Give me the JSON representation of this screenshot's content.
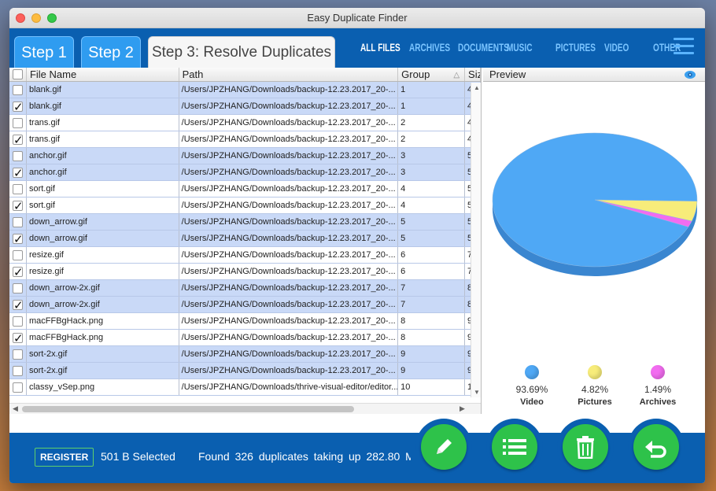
{
  "window": {
    "title": "Easy Duplicate Finder"
  },
  "steps": {
    "step1": "Step 1",
    "step2": "Step 2",
    "step3": "Step 3:  Resolve Duplicates"
  },
  "filters": [
    "ALL FILES",
    "ARCHIVES",
    "DOCUMENTS",
    "MUSIC",
    "PICTURES",
    "VIDEO",
    "OTHER"
  ],
  "table": {
    "headers": {
      "name": "File Name",
      "path": "Path",
      "group": "Group",
      "size": "Siz"
    },
    "rows": [
      {
        "checked": false,
        "name": "blank.gif",
        "path": "/Users/JPZHANG/Downloads/backup-12.23.2017_20-...",
        "group": "1",
        "size": "4",
        "shade": "blue"
      },
      {
        "checked": true,
        "name": "blank.gif",
        "path": "/Users/JPZHANG/Downloads/backup-12.23.2017_20-...",
        "group": "1",
        "size": "4",
        "shade": "blue"
      },
      {
        "checked": false,
        "name": "trans.gif",
        "path": "/Users/JPZHANG/Downloads/backup-12.23.2017_20-...",
        "group": "2",
        "size": "4",
        "shade": "white"
      },
      {
        "checked": true,
        "name": "trans.gif",
        "path": "/Users/JPZHANG/Downloads/backup-12.23.2017_20-...",
        "group": "2",
        "size": "4",
        "shade": "white"
      },
      {
        "checked": false,
        "name": "anchor.gif",
        "path": "/Users/JPZHANG/Downloads/backup-12.23.2017_20-...",
        "group": "3",
        "size": "5",
        "shade": "blue"
      },
      {
        "checked": true,
        "name": "anchor.gif",
        "path": "/Users/JPZHANG/Downloads/backup-12.23.2017_20-...",
        "group": "3",
        "size": "5",
        "shade": "blue"
      },
      {
        "checked": false,
        "name": "sort.gif",
        "path": "/Users/JPZHANG/Downloads/backup-12.23.2017_20-...",
        "group": "4",
        "size": "5",
        "shade": "white"
      },
      {
        "checked": true,
        "name": "sort.gif",
        "path": "/Users/JPZHANG/Downloads/backup-12.23.2017_20-...",
        "group": "4",
        "size": "5",
        "shade": "white"
      },
      {
        "checked": false,
        "name": "down_arrow.gif",
        "path": "/Users/JPZHANG/Downloads/backup-12.23.2017_20-...",
        "group": "5",
        "size": "5",
        "shade": "blue"
      },
      {
        "checked": true,
        "name": "down_arrow.gif",
        "path": "/Users/JPZHANG/Downloads/backup-12.23.2017_20-...",
        "group": "5",
        "size": "5",
        "shade": "blue"
      },
      {
        "checked": false,
        "name": "resize.gif",
        "path": "/Users/JPZHANG/Downloads/backup-12.23.2017_20-...",
        "group": "6",
        "size": "7",
        "shade": "white"
      },
      {
        "checked": true,
        "name": "resize.gif",
        "path": "/Users/JPZHANG/Downloads/backup-12.23.2017_20-...",
        "group": "6",
        "size": "7",
        "shade": "white"
      },
      {
        "checked": false,
        "name": "down_arrow-2x.gif",
        "path": "/Users/JPZHANG/Downloads/backup-12.23.2017_20-...",
        "group": "7",
        "size": "8",
        "shade": "blue"
      },
      {
        "checked": true,
        "name": "down_arrow-2x.gif",
        "path": "/Users/JPZHANG/Downloads/backup-12.23.2017_20-...",
        "group": "7",
        "size": "8",
        "shade": "blue"
      },
      {
        "checked": false,
        "name": "macFFBgHack.png",
        "path": "/Users/JPZHANG/Downloads/backup-12.23.2017_20-...",
        "group": "8",
        "size": "9",
        "shade": "white"
      },
      {
        "checked": true,
        "name": "macFFBgHack.png",
        "path": "/Users/JPZHANG/Downloads/backup-12.23.2017_20-...",
        "group": "8",
        "size": "9",
        "shade": "white"
      },
      {
        "checked": false,
        "name": "sort-2x.gif",
        "path": "/Users/JPZHANG/Downloads/backup-12.23.2017_20-...",
        "group": "9",
        "size": "9",
        "shade": "blue"
      },
      {
        "checked": false,
        "name": "sort-2x.gif",
        "path": "/Users/JPZHANG/Downloads/backup-12.23.2017_20-...",
        "group": "9",
        "size": "9",
        "shade": "blue"
      },
      {
        "checked": false,
        "name": "classy_vSep.png",
        "path": "/Users/JPZHANG/Downloads/thrive-visual-editor/editor...",
        "group": "10",
        "size": "1",
        "shade": "white"
      }
    ]
  },
  "preview": {
    "label": "Preview",
    "slices": [
      {
        "name": "Video",
        "percent": 93.69,
        "pct_label": "93.69%",
        "color": "#4fa8f5",
        "side": "#3a86d0"
      },
      {
        "name": "Pictures",
        "percent": 4.82,
        "pct_label": "4.82%",
        "color": "#f7ec7a",
        "side": "#c9bd4a"
      },
      {
        "name": "Archives",
        "percent": 1.49,
        "pct_label": "1.49%",
        "color": "#f26cf0",
        "side": "#c046c0"
      }
    ]
  },
  "footer": {
    "register": "REGISTER",
    "selected": "501 B Selected",
    "found": "Found 326 duplicates taking up 282.80 M"
  },
  "actions": [
    "pencil-icon",
    "list-icon",
    "trash-icon",
    "undo-icon"
  ]
}
